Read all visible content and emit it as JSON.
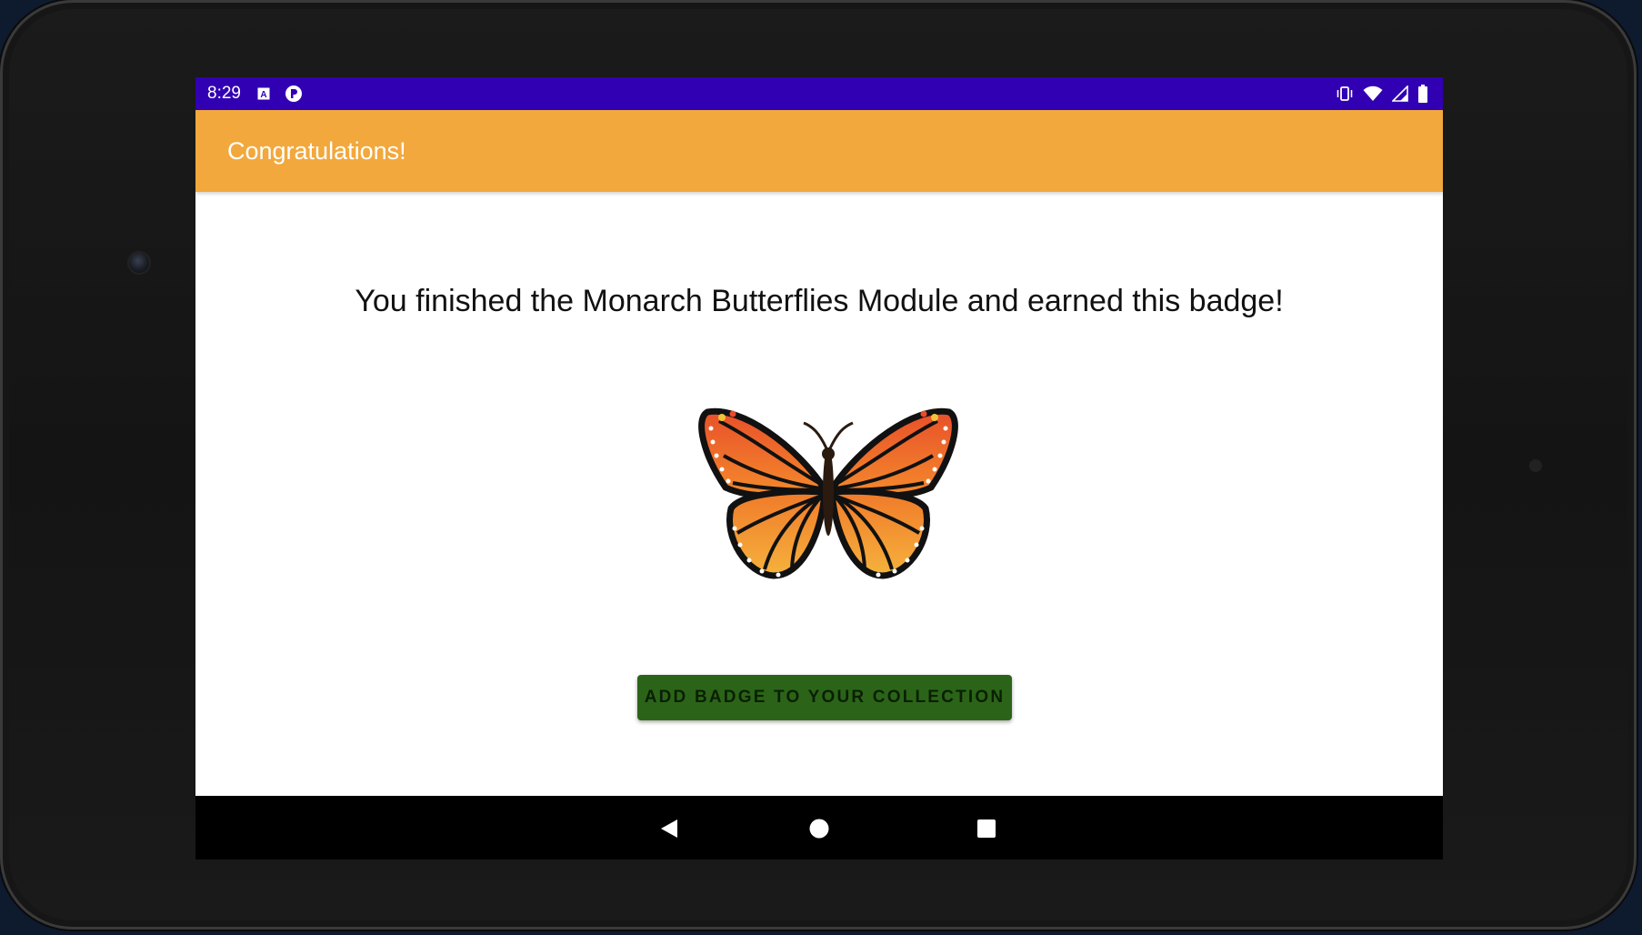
{
  "status_bar": {
    "time": "8:29",
    "left_icons": [
      "text-a-icon",
      "notification-p-icon"
    ],
    "right_icons": [
      "vibrate-icon",
      "wifi-icon",
      "signal-icon",
      "battery-icon"
    ],
    "background": "#3200b3"
  },
  "app_bar": {
    "title": "Congratulations!",
    "background": "#f2a83c"
  },
  "main": {
    "message": "You finished the Monarch Butterflies Module and earned this badge!",
    "badge_icon": "monarch-butterfly-icon",
    "add_button_label": "ADD BADGE TO YOUR COLLECTION",
    "add_button_color": "#2b6418"
  },
  "nav_bar": {
    "buttons": [
      "back-icon",
      "home-icon",
      "recents-icon"
    ]
  }
}
